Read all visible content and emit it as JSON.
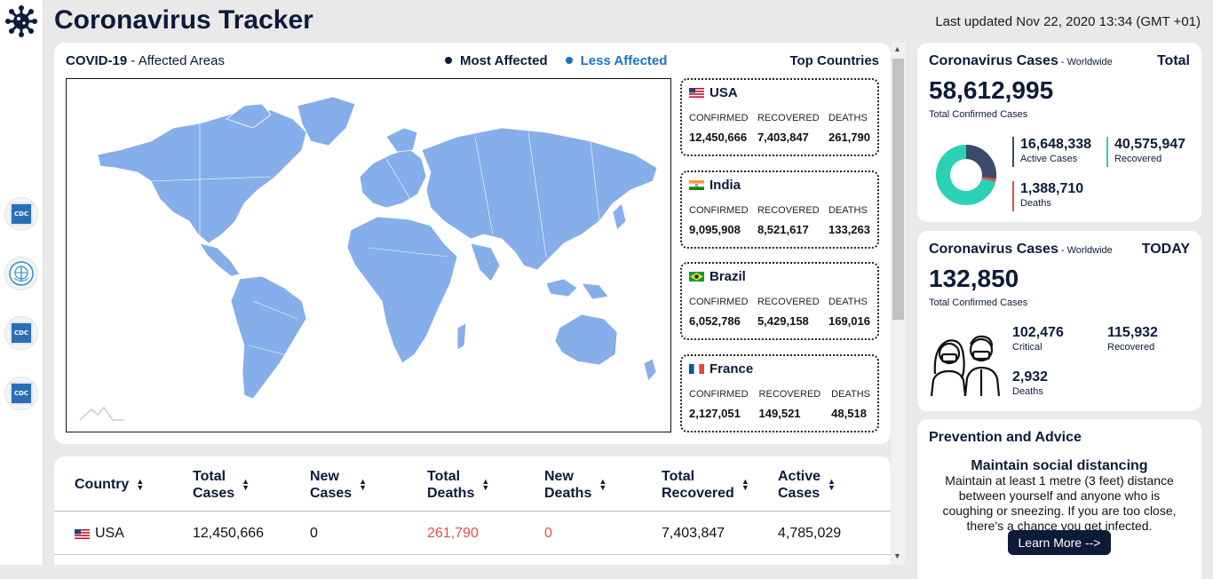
{
  "app": {
    "title": "Coronavirus Tracker",
    "last_updated": "Last updated Nov 22, 2020 13:34 (GMT +01)"
  },
  "sidebar": {
    "sources": [
      {
        "icon": "cdc-logo-icon",
        "label": "CDC"
      },
      {
        "icon": "who-logo-icon",
        "label": ""
      },
      {
        "icon": "cdc-logo-icon",
        "label": "CDC"
      },
      {
        "icon": "cdc-logo-icon",
        "label": "CDC"
      }
    ]
  },
  "map": {
    "title_bold": "COVID-19",
    "title_rest": " - Affected Areas",
    "legend": [
      {
        "label": "Most Affected",
        "color": "#0d1b3a"
      },
      {
        "label": "Less Affected",
        "color": "#1a73c9"
      }
    ],
    "fill_color": "#85aeea",
    "top_label": "Top Countries",
    "top_countries": [
      {
        "name": "USA",
        "flag": "us-flag-icon",
        "confirmed_label": "CONFIRMED",
        "recovered_label": "RECOVERED",
        "deaths_label": "DEATHS",
        "confirmed": "12,450,666",
        "recovered": "7,403,847",
        "deaths": "261,790"
      },
      {
        "name": "India",
        "flag": "india-flag-icon",
        "confirmed_label": "CONFIRMED",
        "recovered_label": "RECOVERED",
        "deaths_label": "DEATHS",
        "confirmed": "9,095,908",
        "recovered": "8,521,617",
        "deaths": "133,263"
      },
      {
        "name": "Brazil",
        "flag": "brazil-flag-icon",
        "confirmed_label": "CONFIRMED",
        "recovered_label": "RECOVERED",
        "deaths_label": "DEATHS",
        "confirmed": "6,052,786",
        "recovered": "5,429,158",
        "deaths": "169,016"
      },
      {
        "name": "France",
        "flag": "france-flag-icon",
        "confirmed_label": "CONFIRMED",
        "recovered_label": "RECOVERED",
        "deaths_label": "DEATHS",
        "confirmed": "2,127,051",
        "recovered": "149,521",
        "deaths": "48,518"
      }
    ]
  },
  "table": {
    "headers": [
      [
        "Country",
        ""
      ],
      [
        "Total",
        "Cases"
      ],
      [
        "New",
        "Cases"
      ],
      [
        "Total",
        "Deaths"
      ],
      [
        "New",
        "Deaths"
      ],
      [
        "Total",
        "Recovered"
      ],
      [
        "Active",
        "Cases"
      ]
    ],
    "rows": [
      {
        "country": "USA",
        "total_cases": "12,450,666",
        "new_cases": "0",
        "total_deaths": "261,790",
        "new_deaths": "0",
        "total_recovered": "7,403,847",
        "active_cases": "4,785,029"
      }
    ]
  },
  "total_card": {
    "title": "Coronavirus Cases",
    "scope": " - Worldwide",
    "tag": "Total",
    "value": "58,612,995",
    "value_label": "Total Confirmed Cases",
    "active": "16,648,338",
    "active_label": "Active Cases",
    "recovered": "40,575,947",
    "recovered_label": "Recovered",
    "deaths": "1,388,710",
    "deaths_label": "Deaths",
    "colors": {
      "active": "#3a4a6b",
      "recovered": "#2bd1b6",
      "deaths": "#e0504a"
    }
  },
  "today_card": {
    "title": "Coronavirus Cases",
    "scope": " - Worldwide",
    "tag": "TODAY",
    "value": "132,850",
    "value_label": "Total Confirmed Cases",
    "critical": "102,476",
    "critical_label": "Critical",
    "recovered": "115,932",
    "recovered_label": "Recovered",
    "deaths": "2,932",
    "deaths_label": "Deaths"
  },
  "advice": {
    "title": "Prevention and Advice",
    "heading": "Maintain social distancing",
    "text": "Maintain at least 1 metre (3 feet) distance between yourself and anyone who is coughing or sneezing. If you are too close, there's a chance you get infected.",
    "button": "Learn More -->"
  }
}
